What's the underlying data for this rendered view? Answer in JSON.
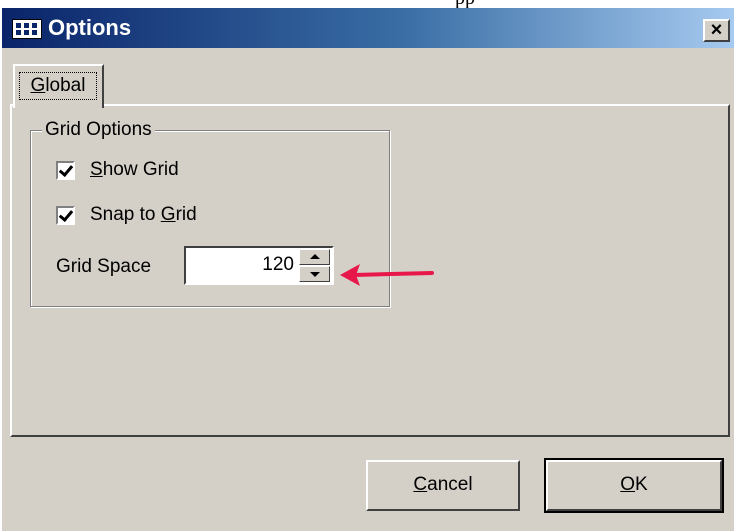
{
  "window": {
    "title": "Options",
    "close_label": "×",
    "clipped_caption": "pp"
  },
  "tabs": [
    {
      "label": "Global",
      "hotkey": "G",
      "rest": "lobal",
      "selected": true
    }
  ],
  "grid_options": {
    "group_title": "Grid Options",
    "show_grid": {
      "pre": "",
      "hotkey": "S",
      "post": "how Grid",
      "checked": true
    },
    "snap_to_grid": {
      "pre": "Snap to ",
      "hotkey": "G",
      "post": "rid",
      "checked": true
    },
    "grid_space": {
      "label": "Grid Space",
      "value": "120"
    }
  },
  "annotation": {
    "arrow_color": "#e8174a"
  },
  "buttons": {
    "cancel": {
      "hotkey": "C",
      "rest": "ancel"
    },
    "ok": {
      "hotkey": "O",
      "rest": "K"
    }
  },
  "colors": {
    "face": "#d4d0c8",
    "title_start": "#0a246a",
    "title_end": "#a6caf0"
  }
}
